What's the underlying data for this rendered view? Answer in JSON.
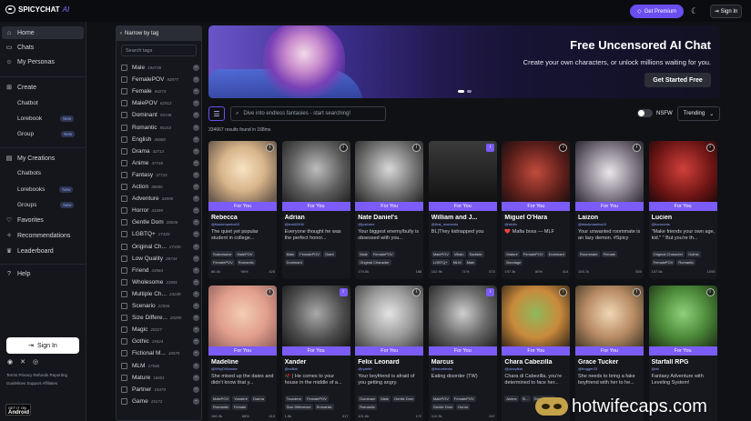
{
  "brand": {
    "name": "SPICYCHAT",
    "suffix": "AI"
  },
  "topbar": {
    "premium_label": "Get Premium",
    "signin_label": "Sign In"
  },
  "sidebar": {
    "home": "Home",
    "chats": "Chats",
    "personas": "My Personas",
    "create": "Create",
    "chatbot": "Chatbot",
    "lorebook": "Lorebook",
    "group": "Group",
    "new": "New",
    "my_creations": "My Creations",
    "chatbots": "Chatbots",
    "lorebooks": "Lorebooks",
    "groups": "Groups",
    "favorites": "Favorites",
    "recommendations": "Recommendations",
    "leaderboard": "Leaderboard",
    "help": "Help",
    "signin": "Sign In",
    "footer": "Terms  Privacy  Refunds  Reporting  Guidelines  Support  Affiliates",
    "android_top": "GET IT ON",
    "android": "Android"
  },
  "tags": {
    "header": "Narrow by tag",
    "search_placeholder": "Search tags",
    "items": [
      {
        "name": "Male",
        "count": "194736"
      },
      {
        "name": "FemalePOV",
        "count": "92877"
      },
      {
        "name": "Female",
        "count": "94273"
      },
      {
        "name": "MalePOV",
        "count": "62912"
      },
      {
        "name": "Dominant",
        "count": "55746"
      },
      {
        "name": "Romantic",
        "count": "55153"
      },
      {
        "name": "English",
        "count": "45660"
      },
      {
        "name": "Drama",
        "count": "42713"
      },
      {
        "name": "Anime",
        "count": "37746"
      },
      {
        "name": "Fantasy",
        "count": "37715"
      },
      {
        "name": "Action",
        "count": "36000"
      },
      {
        "name": "Adventure",
        "count": "34590"
      },
      {
        "name": "Horror",
        "count": "33499"
      },
      {
        "name": "Gentle Dom",
        "count": "28036"
      },
      {
        "name": "LGBTQ+",
        "count": "27420"
      },
      {
        "name": "Original Ch...",
        "count": "27335"
      },
      {
        "name": "Low Quality",
        "count": "26744"
      },
      {
        "name": "Friend",
        "count": "24564"
      },
      {
        "name": "Wholesome",
        "count": "23591"
      },
      {
        "name": "Multiple Ch...",
        "count": "23249"
      },
      {
        "name": "Scenario",
        "count": "22556"
      },
      {
        "name": "Size Differe...",
        "count": "20295"
      },
      {
        "name": "Magic",
        "count": "20227"
      },
      {
        "name": "Gothic",
        "count": "19424"
      },
      {
        "name": "Fictional M...",
        "count": "18575"
      },
      {
        "name": "MLM",
        "count": "17546"
      },
      {
        "name": "Mature",
        "count": "16651"
      },
      {
        "name": "Partner",
        "count": "15479"
      },
      {
        "name": "Game",
        "count": "15172"
      }
    ]
  },
  "banner": {
    "title": "Free Uncensored AI Chat",
    "subtitle": "Create your own characters, or unlock millions waiting for you.",
    "cta": "Get Started Free"
  },
  "toolbar": {
    "search_placeholder": "Dive into endless fantasies - start searching!",
    "nsfw_label": "NSFW",
    "sort_value": "Trending",
    "results": "334667 results found in 168ms"
  },
  "for_you": "For You",
  "cards": [
    {
      "name": "Rebecca",
      "handle": "@blackmamba10",
      "desc": "The quiet yet popular student in college...",
      "tags": [
        "Submissive",
        "MalePOV",
        "FemalePOV",
        "Romantic"
      ],
      "s1": "86.4k",
      "s2": "96%",
      "s3": "425"
    },
    {
      "name": "Adrian",
      "handle": "@lemil2006",
      "desc": "Everyone thought he was the perfect honor...",
      "tags": [
        "Male",
        "FemalePOV",
        "Giant",
        "Dominant"
      ],
      "s1": "",
      "s2": "",
      "s3": ""
    },
    {
      "name": "Nate Daniel's",
      "handle": "@justhere",
      "desc": "Your biggest enemy/bully is obsessed with you...",
      "tags": [
        "Male",
        "FemalePOV",
        "Original Character"
      ],
      "s1": "179.0k",
      "s2": "",
      "s3": "188"
    },
    {
      "name": "William and J...",
      "handle": "@that_moments",
      "desc": "BL|They kidnapped you",
      "tags": [
        "MalePOV",
        "Villain",
        "Sadistic",
        "LGBTQ+",
        "MLM",
        "Male"
      ],
      "s1": "102.9k",
      "s2": "71%",
      "s3": "573"
    },
    {
      "name": "Miguel O'Hara",
      "handle": "@siidfo",
      "desc": "❤️ Mafia boss — MLF",
      "tags": [
        "Mature",
        "FemalePOV",
        "Dominant",
        "Bondage"
      ],
      "s1": "197.3k",
      "s2": "80%",
      "s3": "414"
    },
    {
      "name": "Laizon",
      "handle": "@blackmamba10",
      "desc": "Your unwanted roommate is an lazy demon. #Spicy",
      "tags": [
        "Roommate",
        "Female"
      ],
      "s1": "105.7k",
      "s2": "",
      "s3": "550"
    },
    {
      "name": "Lucien",
      "handle": "@lucmoras",
      "desc": "\"Make friends your own age, kid.\" \" But you're th...",
      "tags": [
        "Original Character",
        "Gothic",
        "FemalePOV",
        "Romantic"
      ],
      "s1": "157.6k",
      "s2": "",
      "s3": "1095"
    },
    {
      "name": "Madeline",
      "handle": "@WhyDWonder",
      "desc": "She mixed up the dates and didn't know that y...",
      "tags": [
        "MalePOV",
        "Yandere",
        "Drama",
        "Romantic",
        "Female"
      ],
      "s1": "160.3k",
      "s2": "68%",
      "s3": "413"
    },
    {
      "name": "Xander",
      "handle": "@xxBat",
      "desc": "🥀 | He comes to your house in the middle of a...",
      "tags": [
        "Tsundere",
        "FemalePOV",
        "Size Difference",
        "Romantic"
      ],
      "s1": "1.5k",
      "s2": "",
      "s3": "417"
    },
    {
      "name": "Felix Leonard",
      "handle": "@ryanfrr",
      "desc": "Your boyfriend is afraid of you getting angry.",
      "tags": [
        "Dominant",
        "Male",
        "Gentle Dom",
        "Romantic"
      ],
      "s1": "101.6k",
      "s2": "",
      "s3": "172"
    },
    {
      "name": "Marcus",
      "handle": "@traumlewis",
      "desc": "Eating disorder (TW)",
      "tags": [
        "MalePOV",
        "FemalePOV",
        "Gentle Dom",
        "Horror"
      ],
      "s1": "110.3k",
      "s2": "",
      "s3": "247"
    },
    {
      "name": "Chara Cabezilla",
      "handle": "@pizzyfkar",
      "desc": "Chara di Cabezilla, you're determined to face her...",
      "tags": [
        "Anime",
        "Sl...",
        "Gentle Dom"
      ],
      "s1": "",
      "s2": "",
      "s3": ""
    },
    {
      "name": "Grace Tucker",
      "handle": "@frogger23",
      "desc": "She needs to bring a fake boyfriend with her to he...",
      "tags": [],
      "s1": "",
      "s2": "",
      "s3": ""
    },
    {
      "name": "Starfall RPG",
      "handle": "@rtv",
      "desc": "Fantasy Adventure with Leveling System!",
      "tags": [],
      "s1": "",
      "s2": "",
      "s3": ""
    }
  ],
  "watermark": "hotwifecaps.com"
}
